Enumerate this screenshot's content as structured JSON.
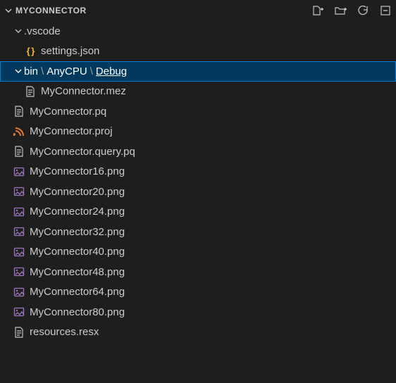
{
  "header": {
    "title": "MYCONNECTOR"
  },
  "tree": {
    "vscode": {
      "name": ".vscode",
      "children": {
        "settings": {
          "name": "settings.json"
        }
      }
    },
    "bin": {
      "seg1": "bin",
      "seg2": "AnyCPU",
      "seg3": "Debug",
      "children": {
        "mez": {
          "name": "MyConnector.mez"
        }
      }
    },
    "files": [
      {
        "name": "MyConnector.pq",
        "icon": "file"
      },
      {
        "name": "MyConnector.proj",
        "icon": "proj"
      },
      {
        "name": "MyConnector.query.pq",
        "icon": "file"
      },
      {
        "name": "MyConnector16.png",
        "icon": "img"
      },
      {
        "name": "MyConnector20.png",
        "icon": "img"
      },
      {
        "name": "MyConnector24.png",
        "icon": "img"
      },
      {
        "name": "MyConnector32.png",
        "icon": "img"
      },
      {
        "name": "MyConnector40.png",
        "icon": "img"
      },
      {
        "name": "MyConnector48.png",
        "icon": "img"
      },
      {
        "name": "MyConnector64.png",
        "icon": "img"
      },
      {
        "name": "MyConnector80.png",
        "icon": "img"
      },
      {
        "name": "resources.resx",
        "icon": "file"
      }
    ]
  }
}
